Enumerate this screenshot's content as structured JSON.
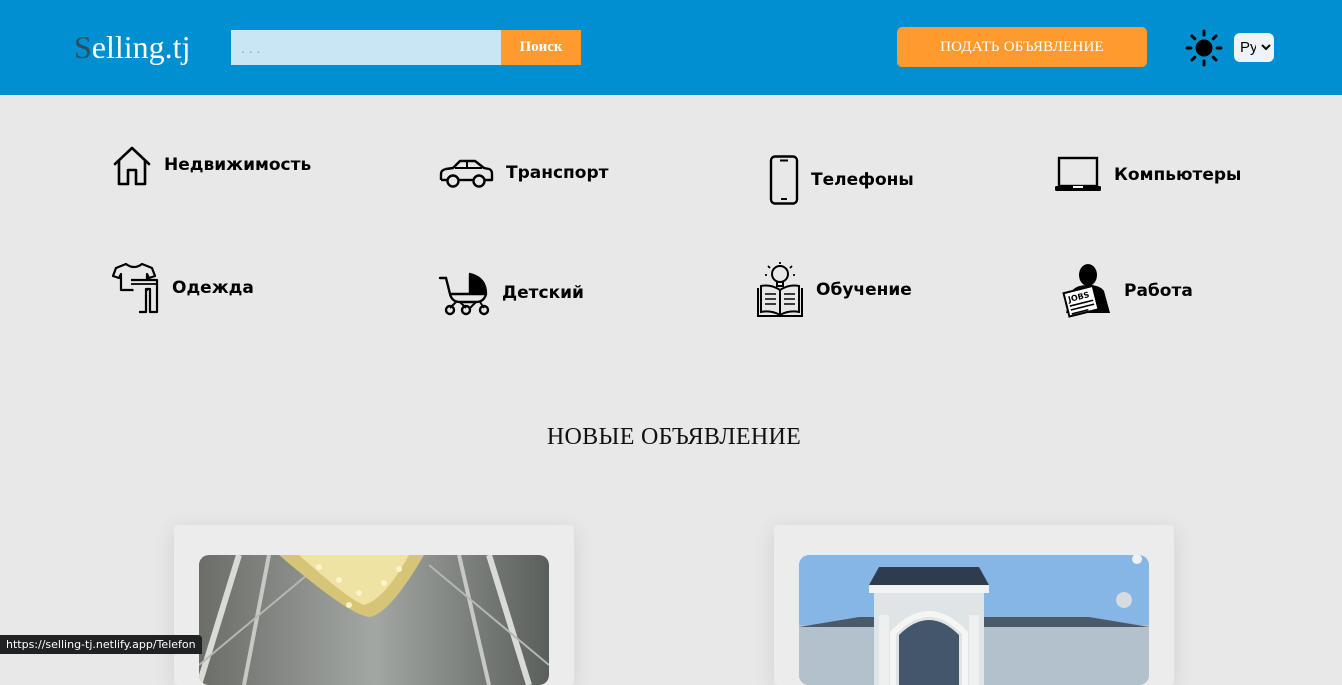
{
  "header": {
    "logo_first": "S",
    "logo_rest": "elling.tj",
    "search_placeholder": ". . .",
    "search_button": "Поиск",
    "post_button": "ПОДАТЬ ОБЪЯВЛЕНИЕ",
    "theme_icon": "sun-icon",
    "language_selected": "Ру"
  },
  "categories": [
    {
      "label": "Недвижимость",
      "icon": "house-icon"
    },
    {
      "label": "Транспорт",
      "icon": "car-icon"
    },
    {
      "label": "Телефоны",
      "icon": "phone-icon"
    },
    {
      "label": "Компьютеры",
      "icon": "laptop-icon"
    },
    {
      "label": "Одежда",
      "icon": "clothes-icon"
    },
    {
      "label": "Детский",
      "icon": "stroller-icon"
    },
    {
      "label": "Обучение",
      "icon": "book-lightbulb-icon"
    },
    {
      "label": "Работа",
      "icon": "jobs-newspaper-icon"
    }
  ],
  "section_title": "НОВЫЕ ОБЪЯВЛЕНИЕ",
  "status_bar": "https://selling-tj.netlify.app/Telefon",
  "colors": {
    "header_bg": "#0090d1",
    "accent": "#ff9a2e",
    "page_bg": "#e8e8e8"
  }
}
